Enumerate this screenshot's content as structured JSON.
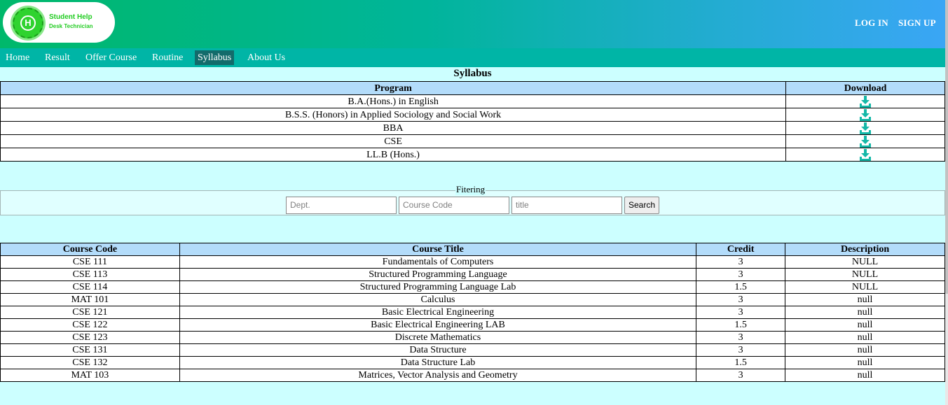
{
  "header": {
    "logo_letter": "H",
    "logo_line1": "Student Help",
    "logo_line2": "Desk Technician",
    "login": "LOG IN",
    "signup": "SIGN UP"
  },
  "nav": {
    "items": [
      {
        "label": "Home"
      },
      {
        "label": "Result"
      },
      {
        "label": "Offer Course"
      },
      {
        "label": "Routine"
      },
      {
        "label": "Syllabus",
        "active": true
      },
      {
        "label": "About Us"
      }
    ]
  },
  "syllabus": {
    "title": "Syllabus",
    "headers": [
      "Program",
      "Download"
    ],
    "programs": [
      "B.A.(Hons.) in English",
      "B.S.S. (Honors) in Applied Sociology and Social Work",
      "BBA",
      "CSE",
      "LL.B (Hons.)"
    ],
    "download_icon": "download-icon"
  },
  "filter": {
    "legend": "Fitering",
    "dept_placeholder": "Dept.",
    "code_placeholder": "Course Code",
    "title_placeholder": "title",
    "search_label": "Search"
  },
  "courses": {
    "headers": [
      "Course Code",
      "Course Title",
      "Credit",
      "Description"
    ],
    "rows": [
      [
        "CSE 111",
        "Fundamentals of Computers",
        "3",
        "NULL"
      ],
      [
        "CSE 113",
        "Structured Programming Language",
        "3",
        "NULL"
      ],
      [
        "CSE 114",
        "Structured Programming Language Lab",
        "1.5",
        "NULL"
      ],
      [
        "MAT 101",
        "Calculus",
        "3",
        "null"
      ],
      [
        "CSE 121",
        "Basic Electrical Engineering",
        "3",
        "null"
      ],
      [
        "CSE 122",
        "Basic Electrical Engineering LAB",
        "1.5",
        "null"
      ],
      [
        "CSE 123",
        "Discrete Mathematics",
        "3",
        "null"
      ],
      [
        "CSE 131",
        "Data Structure",
        "3",
        "null"
      ],
      [
        "CSE 132",
        "Data Structure Lab",
        "1.5",
        "null"
      ],
      [
        "MAT 103",
        "Matrices, Vector Analysis and Geometry",
        "3",
        "null"
      ]
    ]
  },
  "colors": {
    "accent": "#00b5a6",
    "icon": "#14b8a8",
    "header_cell": "#b3dcfa",
    "page_bg": "#ccffff"
  }
}
